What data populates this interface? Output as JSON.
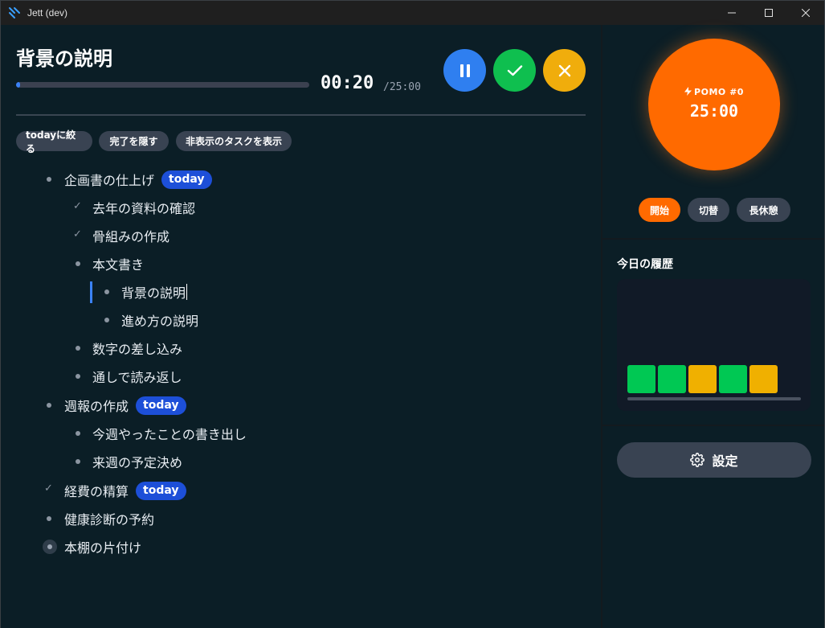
{
  "window": {
    "title": "Jett (dev)"
  },
  "current_task": {
    "title": "背景の説明",
    "elapsed": "00:20",
    "total": "/25:00",
    "progress_fraction": 0.013
  },
  "filters": {
    "today_only": "todayに絞る",
    "hide_done": "完了を隠す",
    "show_hidden": "非表示のタスクを表示"
  },
  "tasks": [
    {
      "text": "企画書の仕上げ",
      "badge": "today",
      "state": "open"
    },
    {
      "text": "去年の資料の確認",
      "state": "done"
    },
    {
      "text": "骨組みの作成",
      "state": "done"
    },
    {
      "text": "本文書き",
      "state": "open"
    },
    {
      "text": "背景の説明",
      "state": "open"
    },
    {
      "text": "進め方の説明",
      "state": "open"
    },
    {
      "text": "数字の差し込み",
      "state": "open"
    },
    {
      "text": "通しで読み返し",
      "state": "open"
    },
    {
      "text": "週報の作成",
      "badge": "today",
      "state": "open"
    },
    {
      "text": "今週やったことの書き出し",
      "state": "open"
    },
    {
      "text": "来週の予定決め",
      "state": "open"
    },
    {
      "text": "経費の精算",
      "badge": "today",
      "state": "done"
    },
    {
      "text": "健康診断の予約",
      "state": "open"
    },
    {
      "text": "本棚の片付け",
      "state": "open"
    }
  ],
  "pomodoro": {
    "label": "POMO #0",
    "time": "25:00",
    "color": "#ff6a00",
    "buttons": {
      "start": "開始",
      "switch": "切替",
      "long_break": "長休憩"
    }
  },
  "history": {
    "title": "今日の履歴",
    "blocks": [
      "#00c853",
      "#00c853",
      "#f0b000",
      "#00c853",
      "#f0b000"
    ]
  },
  "settings": {
    "label": "設定"
  },
  "colors": {
    "accent": "#3b82f6",
    "today_badge": "#1d4fd8",
    "done": "#0fbf4f",
    "cancel": "#f0ad0c"
  }
}
